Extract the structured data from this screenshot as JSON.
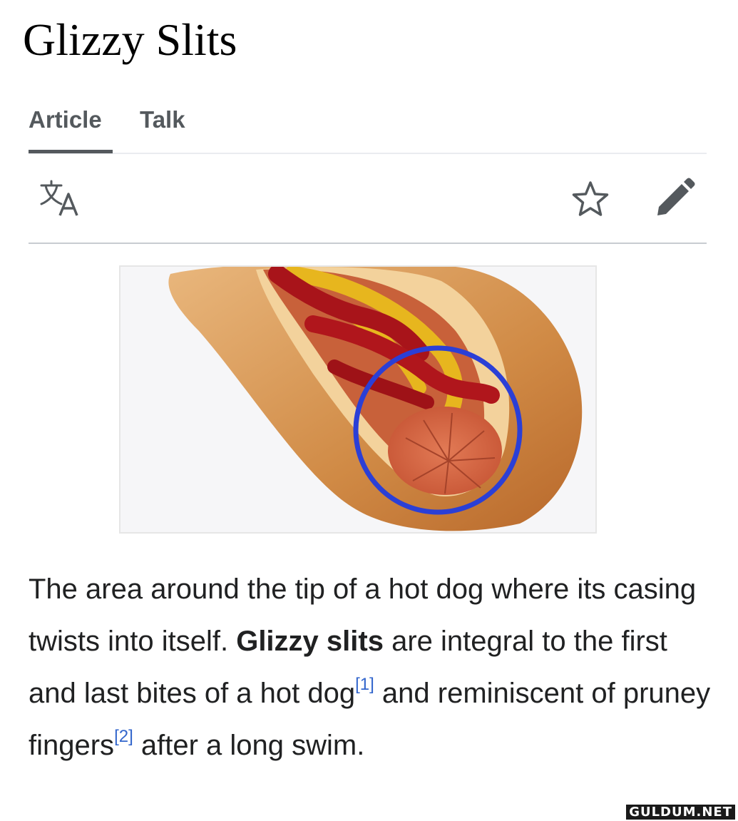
{
  "page": {
    "title": "Glizzy Slits"
  },
  "tabs": [
    {
      "label": "Article",
      "active": true
    },
    {
      "label": "Talk",
      "active": false
    }
  ],
  "toolbar": {
    "language_icon": "translate-icon",
    "watch_icon": "star-icon",
    "edit_icon": "pencil-icon"
  },
  "figure": {
    "description": "hot-dog-image",
    "highlight_color": "#2b3fd6"
  },
  "article": {
    "seg1": "The area around the tip of a hot dog where its casing twists into itself. ",
    "bold_term": "Glizzy slits",
    "seg2": " are integral to the first and last bites of a hot dog",
    "ref1": "[1]",
    "seg3": " and reminiscent of pruney fingers",
    "ref2": "[2]",
    "seg4": " after a long swim."
  },
  "watermark": "GULDUM.NET",
  "colors": {
    "text": "#202122",
    "tab_text": "#54595d",
    "divider": "#c8ccd1",
    "link": "#3366cc"
  }
}
